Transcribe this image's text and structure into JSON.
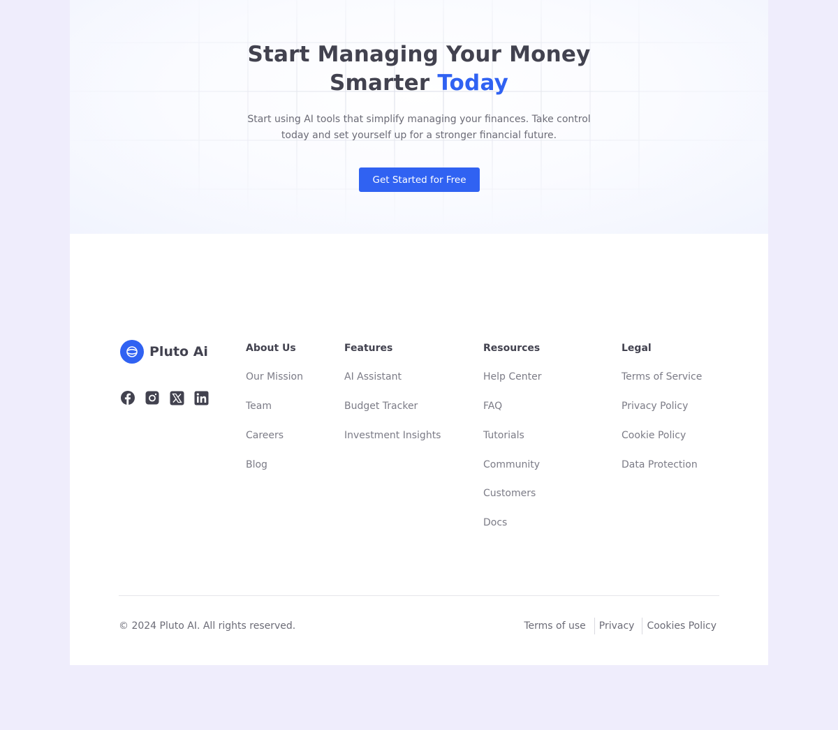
{
  "hero": {
    "title_line1": "Start Managing Your Money",
    "title_line2_prefix": "Smarter ",
    "title_line2_accent": "Today",
    "subtitle": "Start using AI tools that simplify managing your finances. Take control today and set yourself up for a stronger financial future.",
    "cta_label": "Get Started for Free"
  },
  "brand": {
    "name": "Pluto Ai",
    "logo_icon": "pluto-logo-icon"
  },
  "socials": [
    {
      "icon": "facebook-icon"
    },
    {
      "icon": "instagram-icon"
    },
    {
      "icon": "x-twitter-icon"
    },
    {
      "icon": "linkedin-icon"
    }
  ],
  "footer": {
    "columns": [
      {
        "heading": "About Us",
        "links": [
          "Our Mission",
          "Team",
          "Careers",
          "Blog"
        ]
      },
      {
        "heading": "Features",
        "links": [
          "AI Assistant",
          "Budget Tracker",
          "Investment Insights"
        ]
      },
      {
        "heading": "Resources",
        "links": [
          "Help Center",
          "FAQ",
          "Tutorials",
          "Community",
          "Customers",
          "Docs"
        ]
      },
      {
        "heading": "Legal",
        "links": [
          "Terms of Service",
          "Privacy Policy",
          "Cookie Policy",
          "Data Protection"
        ]
      }
    ],
    "copyright": "© 2024 Pluto AI. All rights reserved.",
    "bottom_links": [
      "Terms of use",
      "Privacy",
      "Cookies Policy"
    ]
  },
  "colors": {
    "accent": "#3062f2",
    "text_dark": "#42424f",
    "text_muted": "#7b7b86",
    "outer_background": "#efedfc"
  }
}
